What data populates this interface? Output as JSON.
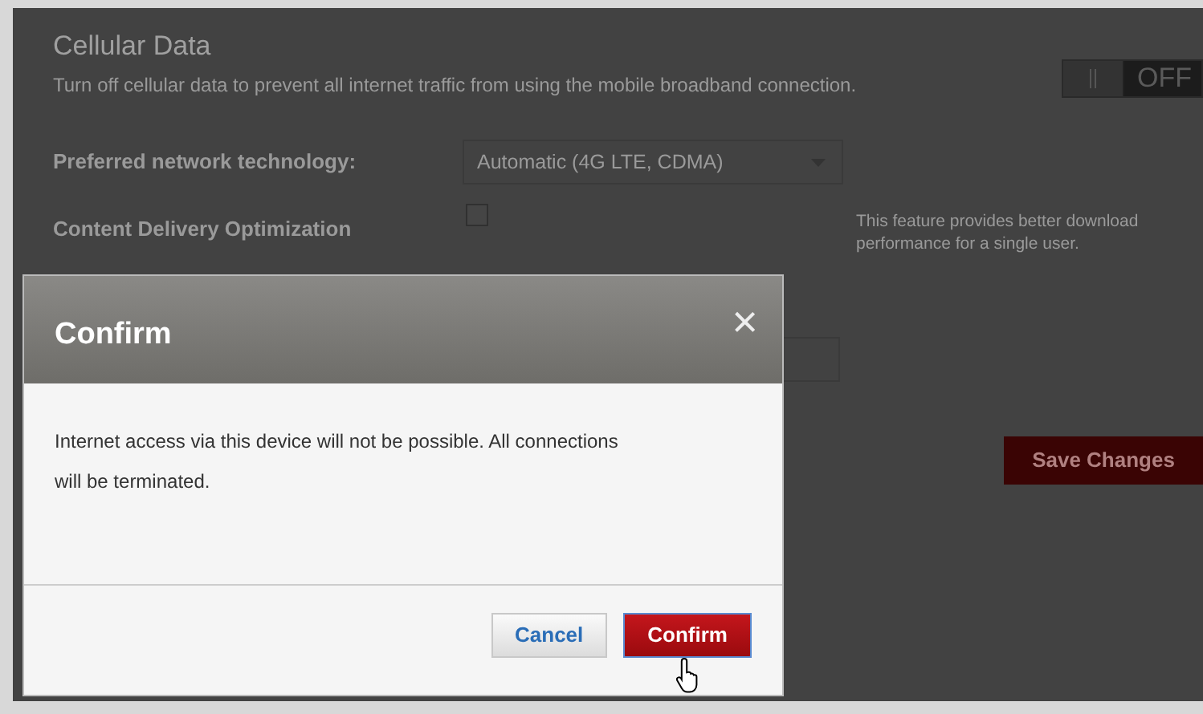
{
  "page": {
    "title": "Cellular Data",
    "description": "Turn off cellular data to prevent all internet traffic from using the mobile broadband connection.",
    "toggle": {
      "label": "OFF",
      "on": false
    },
    "preferred_network": {
      "label": "Preferred network technology:",
      "value": "Automatic (4G LTE, CDMA)"
    },
    "content_delivery": {
      "label": "Content Delivery Optimization",
      "checked": false,
      "help": "This feature provides better download performance for a single user."
    },
    "save_button": "Save Changes"
  },
  "dialog": {
    "title": "Confirm",
    "close": "×",
    "message": "Internet access via this device will not be possible. All connections will be terminated.",
    "buttons": [
      {
        "label": "Cancel",
        "kind": "secondary"
      },
      {
        "label": "Confirm",
        "kind": "primary"
      }
    ]
  }
}
